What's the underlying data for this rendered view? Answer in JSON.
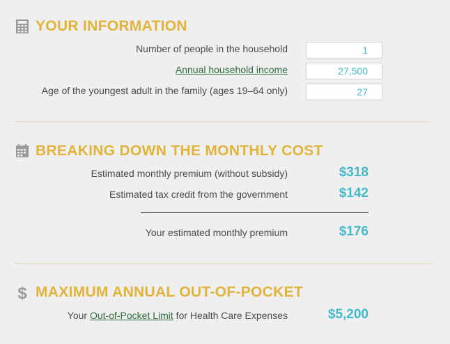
{
  "info": {
    "title": "YOUR INFORMATION",
    "people_label": "Number of people in the household",
    "people_value": "1",
    "income_label": "Annual household income",
    "income_value": "27,500",
    "age_label": "Age of the youngest adult in the family (ages 19–64 only)",
    "age_value": "27"
  },
  "cost": {
    "title": "BREAKING DOWN THE MONTHLY COST",
    "premium_label": "Estimated monthly premium (without subsidy)",
    "premium_value": "$318",
    "credit_label": "Estimated tax credit from the government",
    "credit_value": "$142",
    "yours_label": "Your estimated monthly premium",
    "yours_value": "$176"
  },
  "oop": {
    "title": "MAXIMUM ANNUAL OUT-OF-POCKET",
    "label_prefix": "Your ",
    "label_link": "Out-of-Pocket Limit",
    "label_suffix": " for Health Care Expenses",
    "value": "$5,200"
  },
  "colors": {
    "heading": "#e2b33a",
    "accent": "#45b9c9",
    "link": "#2f6b3c",
    "icon": "#9a9a9a"
  },
  "icons": [
    "calculator-icon",
    "calendar-icon",
    "dollar-icon"
  ]
}
